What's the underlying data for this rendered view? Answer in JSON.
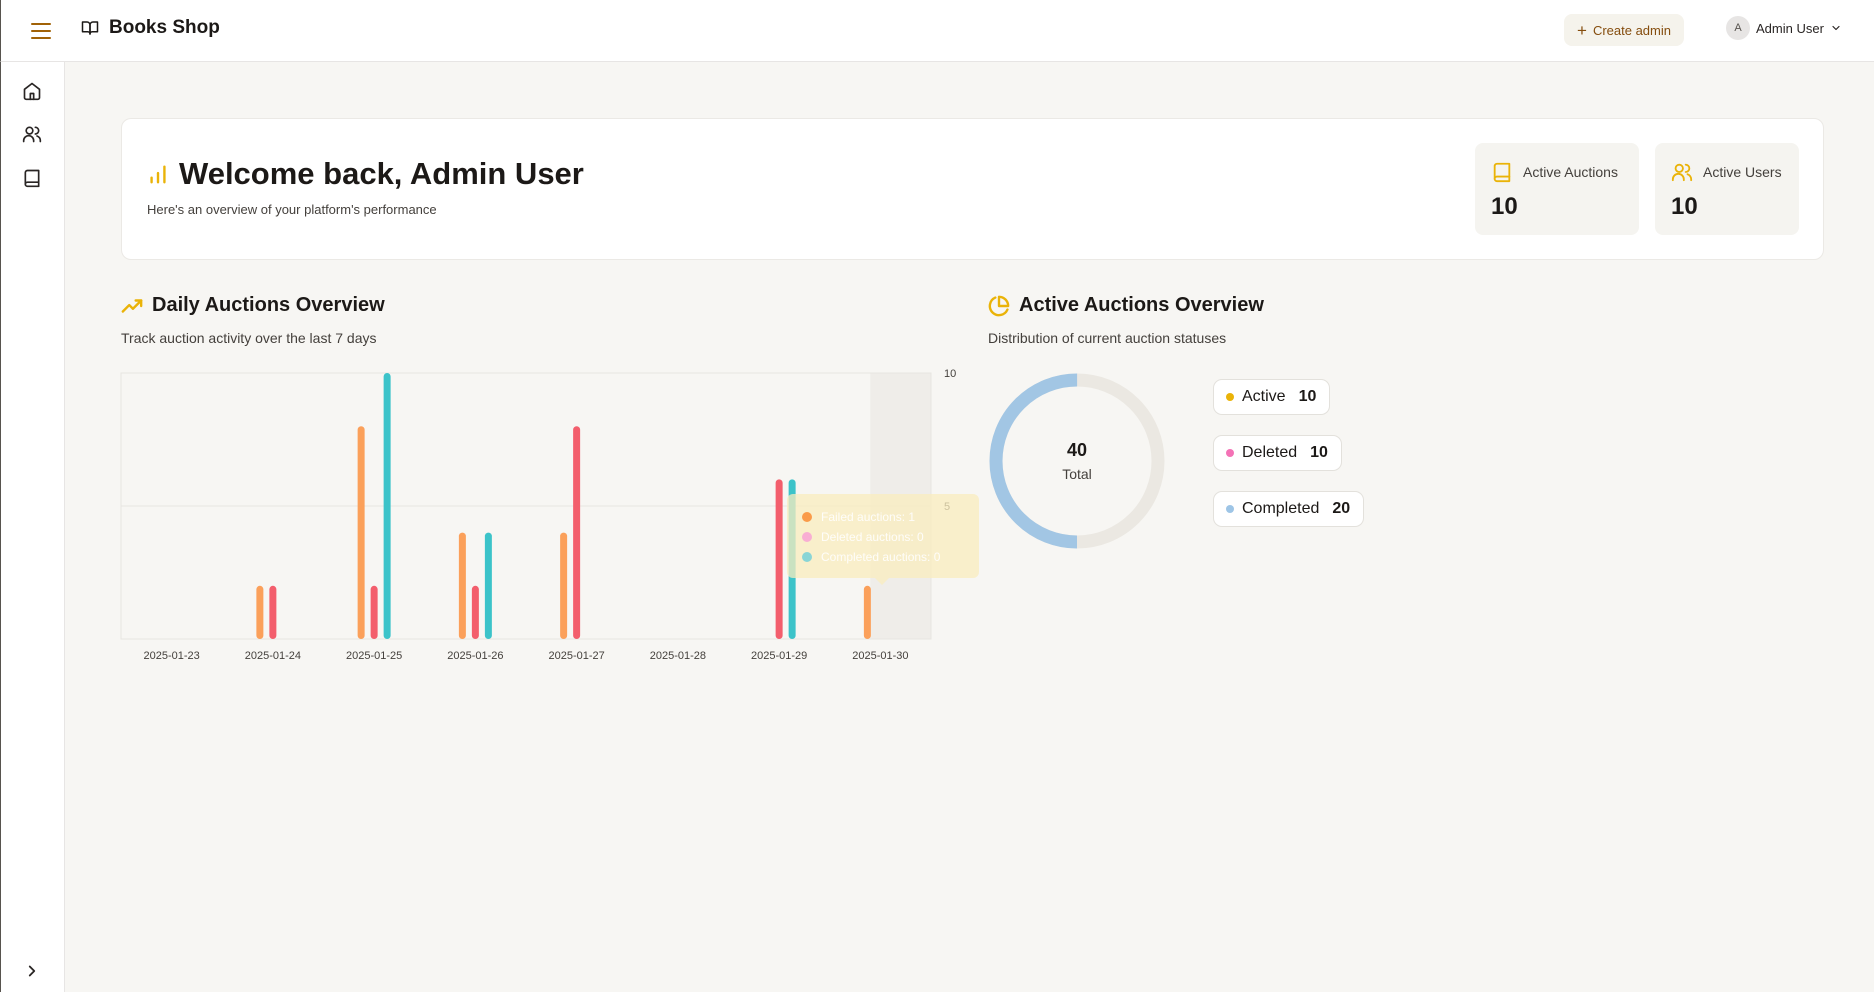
{
  "app": {
    "title": "Books Shop"
  },
  "header": {
    "create_admin_label": "Create admin",
    "user_initial": "A",
    "user_name": "Admin User"
  },
  "sidebar": {
    "items": [
      {
        "icon": "home-icon"
      },
      {
        "icon": "users-icon"
      },
      {
        "icon": "book-icon"
      }
    ],
    "expand_icon": "chevron-right-icon"
  },
  "welcome": {
    "title": "Welcome back, Admin User",
    "subtitle": "Here's an overview of your platform's performance",
    "stats": [
      {
        "label": "Active Auctions",
        "value": "10",
        "icon": "book-icon"
      },
      {
        "label": "Active Users",
        "value": "10",
        "icon": "users-icon"
      }
    ]
  },
  "daily": {
    "title": "Daily Auctions Overview",
    "subtitle": "Track auction activity over the last 7 days"
  },
  "active": {
    "title": "Active Auctions Overview",
    "subtitle": "Distribution of current auction statuses",
    "total": "40",
    "total_label": "Total",
    "legend": [
      {
        "label": "Active",
        "value": "10",
        "color": "#eab308"
      },
      {
        "label": "Deleted",
        "value": "10",
        "color": "#f472b6"
      },
      {
        "label": "Completed",
        "value": "20",
        "color": "#9ec5e6"
      }
    ]
  },
  "tooltip": {
    "rows": [
      {
        "text": "Failed auctions: 1",
        "color": "#fb923c"
      },
      {
        "text": "Deleted auctions: 0",
        "color": "#f43f5e"
      },
      {
        "text": "Completed auctions: 0",
        "color": "#22c5c5"
      }
    ]
  },
  "colors": {
    "accent": "#eab308",
    "failed": "#fba05a",
    "deleted": "#f35e6c",
    "completed": "#3cc3c9"
  },
  "chart_data": [
    {
      "type": "bar",
      "categories": [
        "2025-01-23",
        "2025-01-24",
        "2025-01-25",
        "2025-01-26",
        "2025-01-27",
        "2025-01-28",
        "2025-01-29",
        "2025-01-30"
      ],
      "series": [
        {
          "name": "Failed auctions",
          "color": "#fba05a",
          "values": [
            0,
            2,
            8,
            4,
            4,
            0,
            0,
            2
          ]
        },
        {
          "name": "Deleted auctions",
          "color": "#f35e6c",
          "values": [
            0,
            2,
            2,
            2,
            8,
            0,
            6,
            0
          ]
        },
        {
          "name": "Completed auctions",
          "color": "#3cc3c9",
          "values": [
            0,
            0,
            10,
            4,
            0,
            0,
            6,
            0
          ]
        }
      ],
      "yticks": [
        5,
        10
      ],
      "ylim": [
        0,
        10
      ],
      "grid": true,
      "highlighted_category": "2025-01-30"
    },
    {
      "type": "pie",
      "labels": [
        "Active",
        "Deleted",
        "Completed"
      ],
      "values": [
        10,
        10,
        20
      ],
      "total": 40
    }
  ]
}
